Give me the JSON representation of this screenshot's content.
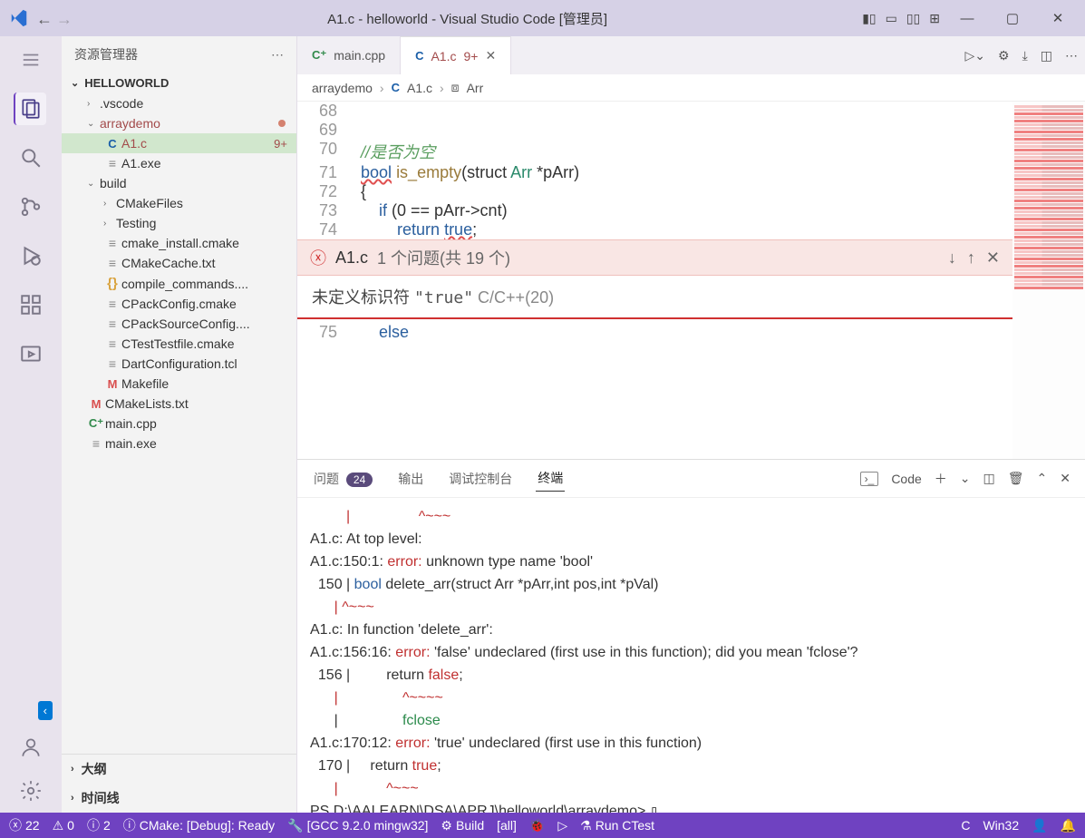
{
  "title": "A1.c - helloworld - Visual Studio Code [管理员]",
  "sidebar": {
    "header": "资源管理器",
    "project": "HELLOWORLD",
    "items": [
      {
        "type": "folder",
        "chev": "›",
        "name": ".vscode",
        "indent": 1
      },
      {
        "type": "folder",
        "chev": "⌄",
        "name": "arraydemo",
        "indent": 1,
        "folderColor": true,
        "dot": true
      },
      {
        "type": "file",
        "icon": "C",
        "name": "A1.c",
        "indent": 2,
        "selected": true,
        "badge": "9+"
      },
      {
        "type": "file",
        "icon": "≡",
        "name": "A1.exe",
        "indent": 2,
        "gray": true
      },
      {
        "type": "folder",
        "chev": "⌄",
        "name": "build",
        "indent": 1
      },
      {
        "type": "folder",
        "chev": "›",
        "name": "CMakeFiles",
        "indent": 2
      },
      {
        "type": "folder",
        "chev": "›",
        "name": "Testing",
        "indent": 2
      },
      {
        "type": "file",
        "icon": "≡",
        "name": "cmake_install.cmake",
        "indent": 2,
        "gray": true
      },
      {
        "type": "file",
        "icon": "≡",
        "name": "CMakeCache.txt",
        "indent": 2,
        "gray": true
      },
      {
        "type": "file",
        "icon": "{}",
        "name": "compile_commands....",
        "indent": 2,
        "json": true
      },
      {
        "type": "file",
        "icon": "≡",
        "name": "CPackConfig.cmake",
        "indent": 2,
        "gray": true
      },
      {
        "type": "file",
        "icon": "≡",
        "name": "CPackSourceConfig....",
        "indent": 2,
        "gray": true
      },
      {
        "type": "file",
        "icon": "≡",
        "name": "CTestTestfile.cmake",
        "indent": 2,
        "gray": true
      },
      {
        "type": "file",
        "icon": "≡",
        "name": "DartConfiguration.tcl",
        "indent": 2,
        "gray": true
      },
      {
        "type": "file",
        "icon": "M",
        "name": "Makefile",
        "indent": 2,
        "mfile": true
      },
      {
        "type": "file",
        "icon": "M",
        "name": "CMakeLists.txt",
        "indent": 1,
        "mfile": true
      },
      {
        "type": "file",
        "icon": "C⁺",
        "name": "main.cpp",
        "indent": 1,
        "cpp": true
      },
      {
        "type": "file",
        "icon": "≡",
        "name": "main.exe",
        "indent": 1,
        "gray": true
      }
    ],
    "outline": "大纲",
    "timeline": "时间线"
  },
  "tabs": {
    "t1": {
      "icon": "C⁺",
      "label": "main.cpp"
    },
    "t2": {
      "icon": "C",
      "label": "A1.c",
      "mod": "9+"
    }
  },
  "breadcrumb": {
    "p1": "arraydemo",
    "p2": "A1.c",
    "p3": "Arr"
  },
  "code": {
    "l68": "68",
    "l69": {
      "n": "69"
    },
    "l70": {
      "n": "70",
      "comment": "//是否为空"
    },
    "l71": {
      "n": "71",
      "bool": "bool",
      "fn": "is_empty",
      "rest": "(struct ",
      "type": "Arr",
      "rest2": " *pArr)"
    },
    "l72": {
      "n": "72",
      "brace": "{"
    },
    "l73": {
      "n": "73",
      "if": "if",
      "cond": " (0 == pArr->cnt)"
    },
    "l74": {
      "n": "74",
      "ret": "return",
      "true": "true",
      ";": ";"
    },
    "l75": {
      "n": "75",
      "else": "else"
    }
  },
  "problem": {
    "file": "A1.c",
    "count_text": "1 个问题(共 19 个)",
    "detail_pre": "未定义标识符 ",
    "detail_quote": "\"true\"",
    "detail_src": " C/C++(20)"
  },
  "panel": {
    "tab_problems": "问题",
    "problems_count": "24",
    "tab_output": "输出",
    "tab_debug": "调试控制台",
    "tab_terminal": "终端",
    "profile": "Code"
  },
  "terminal": {
    "l1": "         |                 ^~~~",
    "l2": "A1.c: At top level:",
    "l3a": "A1.c:150:1: ",
    "l3b": "error:",
    "l3c": " unknown type name 'bool'",
    "l4a": "  150 | ",
    "l4b": "bool",
    "l4c": " delete_arr(struct Arr *pArr,int pos,int *pVal)",
    "l5": "      | ^~~~",
    "l6": "A1.c: In function 'delete_arr':",
    "l7a": "A1.c:156:16: ",
    "l7b": "error:",
    "l7c": " 'false' undeclared (first use in this function); did you mean 'fclose'?",
    "l8a": "  156 |         return ",
    "l8b": "false",
    "l8c": ";",
    "l9": "      |                ^~~~~",
    "l10a": "      |                ",
    "l10b": "fclose",
    "l11a": "A1.c:170:12: ",
    "l11b": "error:",
    "l11c": " 'true' undeclared (first use in this function)",
    "l12a": "  170 |     return ",
    "l12b": "true",
    "l12c": ";",
    "l13": "      |            ^~~~",
    "prompt": "PS D:\\AALEARN\\DSA\\APRJ\\helloworld\\arraydemo> "
  },
  "status": {
    "errors": "22",
    "warnings": "0",
    "info": "2",
    "cmake": "CMake: [Debug]: Ready",
    "kit": "[GCC 9.2.0 mingw32]",
    "build": "Build",
    "target": "[all]",
    "ctest": "Run CTest",
    "lang": "C",
    "arch": "Win32"
  }
}
